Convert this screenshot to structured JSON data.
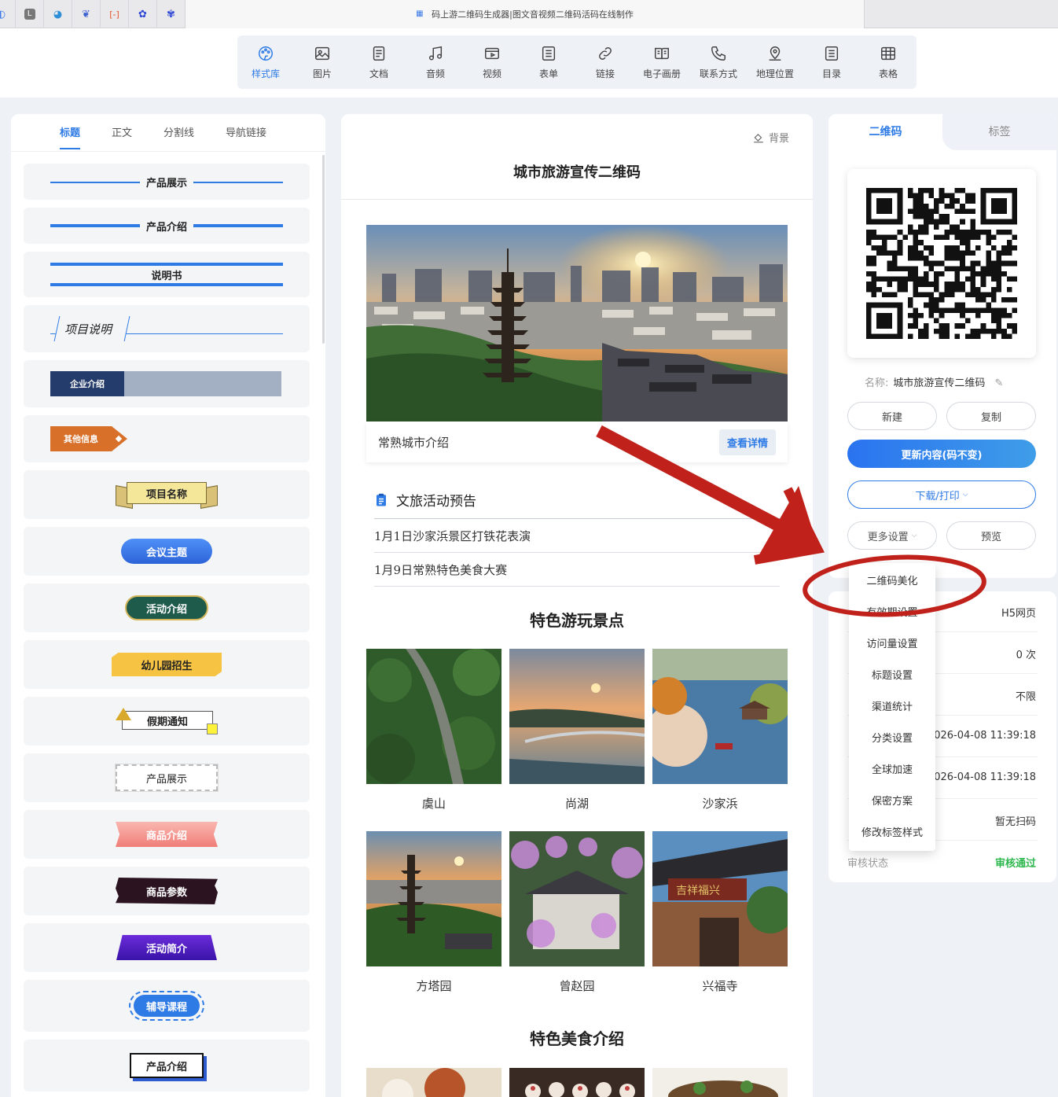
{
  "browser": {
    "tab_title": "码上游二维码生成器|图文音视频二维码活码在线制作",
    "pinned_tabs": [
      "generic-site-icon",
      "l-letter-icon",
      "edge-icon",
      "bird-icon",
      "link-icon",
      "paw-icon",
      "baidu-paw-icon"
    ]
  },
  "toolbar": {
    "items": [
      {
        "label": "样式库",
        "icon": "palette-icon"
      },
      {
        "label": "图片",
        "icon": "image-icon"
      },
      {
        "label": "文档",
        "icon": "document-icon"
      },
      {
        "label": "音频",
        "icon": "music-icon"
      },
      {
        "label": "视频",
        "icon": "video-icon"
      },
      {
        "label": "表单",
        "icon": "form-icon"
      },
      {
        "label": "链接",
        "icon": "link-icon"
      },
      {
        "label": "电子画册",
        "icon": "book-icon"
      },
      {
        "label": "联系方式",
        "icon": "phone-icon"
      },
      {
        "label": "地理位置",
        "icon": "location-icon"
      },
      {
        "label": "目录",
        "icon": "list-icon"
      },
      {
        "label": "表格",
        "icon": "table-icon"
      }
    ],
    "active": "样式库"
  },
  "left_panel": {
    "tabs": [
      "标题",
      "正文",
      "分割线",
      "导航链接"
    ],
    "active_tab": "标题",
    "styles": [
      "产品展示",
      "产品介绍",
      "说明书",
      "项目说明",
      "企业介绍",
      "其他信息",
      "项目名称",
      "会议主题",
      "活动介绍",
      "幼儿园招生",
      "假期通知",
      "产品展示",
      "商品介绍",
      "商品参数",
      "活动简介",
      "辅导课程",
      "产品介绍"
    ]
  },
  "center": {
    "background_btn": "背景",
    "title": "城市旅游宣传二维码",
    "hero_caption": "常熟城市介绍",
    "hero_button": "查看详情",
    "events_header": "文旅活动预告",
    "events": [
      "1月1日沙家浜景区打铁花表演",
      "1月9日常熟特色美食大赛"
    ],
    "spots_header": "特色游玩景点",
    "spots": [
      "虞山",
      "尚湖",
      "沙家浜",
      "方塔园",
      "曾赵园",
      "兴福寺"
    ],
    "food_header": "特色美食介绍"
  },
  "right_panel": {
    "tabs": [
      "二维码",
      "标签"
    ],
    "active_tab": "二维码",
    "name_label": "名称:",
    "name_value": "城市旅游宣传二维码",
    "btn_new": "新建",
    "btn_copy": "复制",
    "btn_update": "更新内容(码不变)",
    "btn_download": "下载/打印",
    "btn_more": "更多设置",
    "btn_preview": "预览",
    "info_values": [
      "H5网页",
      "0 次",
      "不限",
      "026-04-08 11:39:18",
      "026-04-08 11:39:18",
      "暂无扫码"
    ],
    "review_label": "审核状态",
    "review_value": "审核通过",
    "review_color": "#2fb84f"
  },
  "dropdown": {
    "items": [
      "二维码美化",
      "有效期设置",
      "访问量设置",
      "标题设置",
      "渠道统计",
      "分类设置",
      "全球加速",
      "保密方案",
      "修改标签样式"
    ]
  },
  "colors": {
    "accent": "#2e7be6",
    "annotation_red": "#c0221b"
  }
}
